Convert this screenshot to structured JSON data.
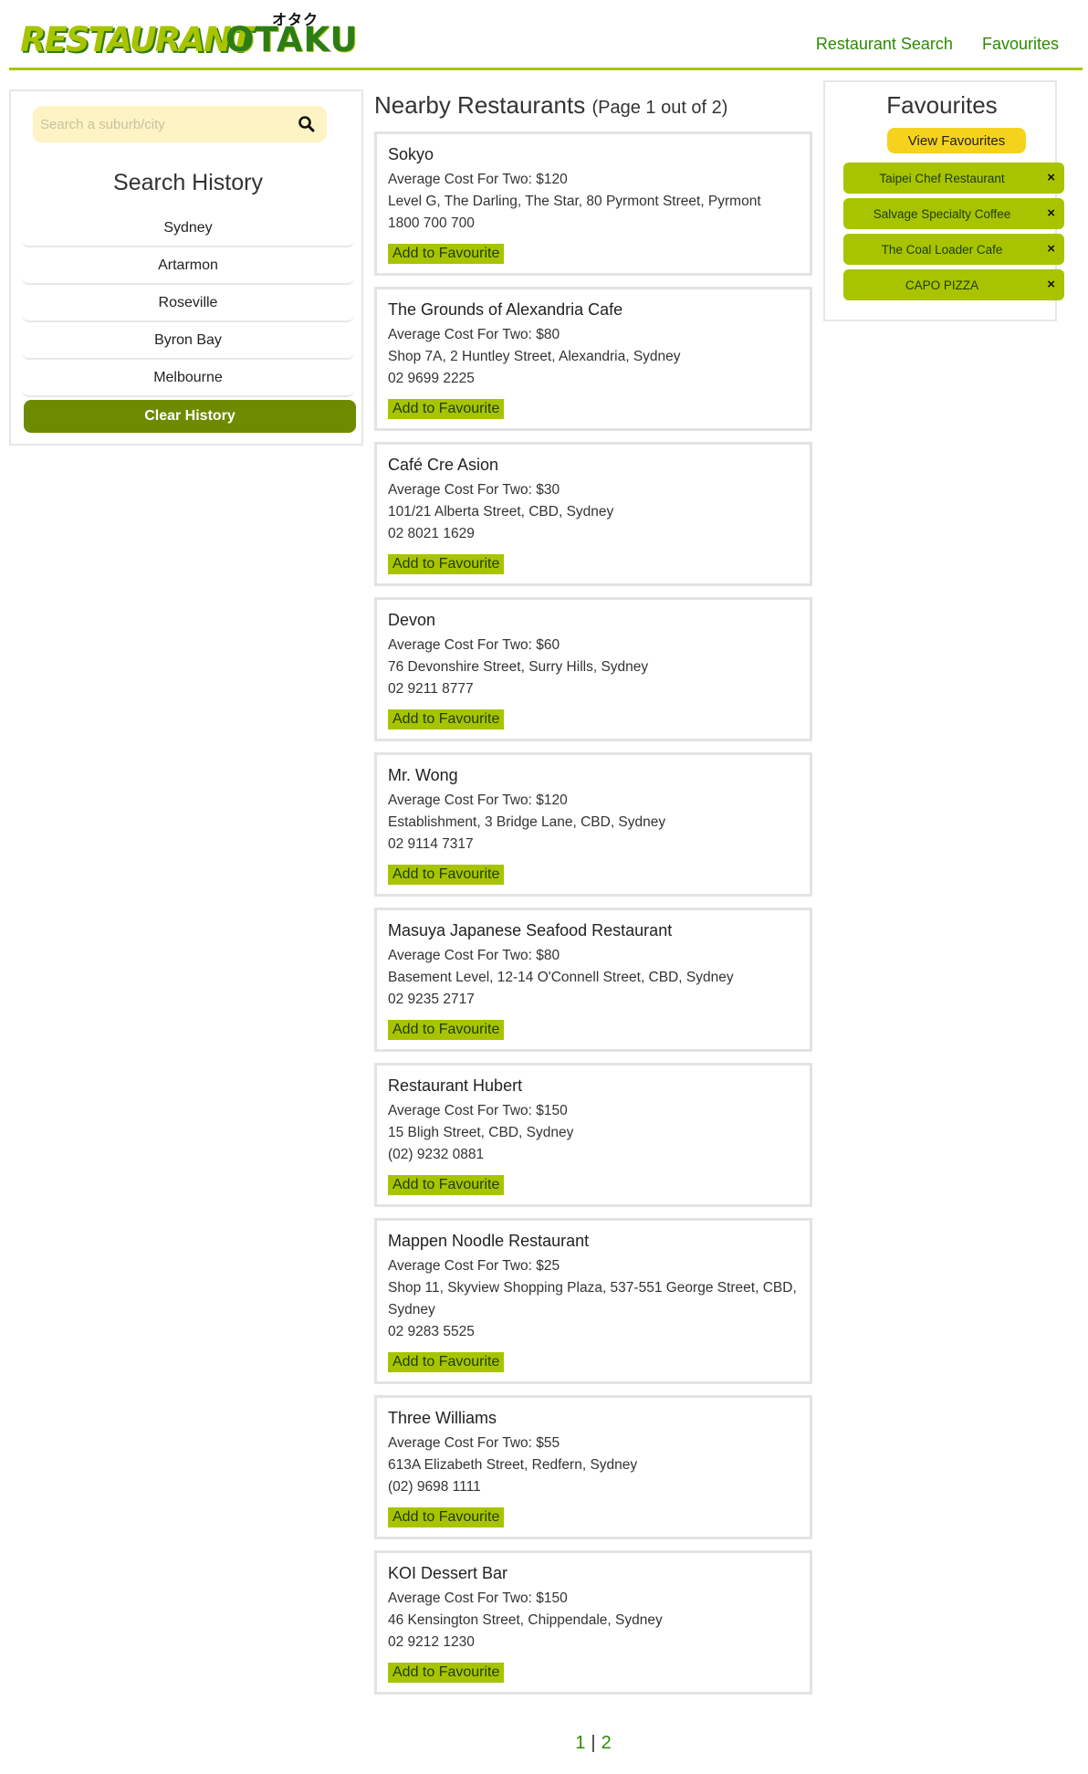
{
  "header": {
    "logo_word_1": "RESTAURANT",
    "logo_word_2": "OTAKU",
    "logo_kana": "オタク",
    "nav": [
      "Restaurant Search",
      "Favourites"
    ]
  },
  "sidebar": {
    "search_placeholder": "Search a suburb/city",
    "history_title": "Search History",
    "history": [
      "Sydney",
      "Artarmon",
      "Roseville",
      "Byron Bay",
      "Melbourne"
    ],
    "clear_label": "Clear History"
  },
  "main": {
    "title": "Nearby Restaurants",
    "page_info": "(Page 1 out of 2)",
    "add_label": "Add to Favourite",
    "restaurants": [
      {
        "name": "Sokyo",
        "cost": "Average Cost For Two: $120",
        "address": "Level G, The Darling, The Star, 80 Pyrmont Street, Pyrmont",
        "phone": "1800 700 700"
      },
      {
        "name": "The Grounds of Alexandria Cafe",
        "cost": "Average Cost For Two: $80",
        "address": "Shop 7A, 2 Huntley Street, Alexandria, Sydney",
        "phone": "02 9699 2225"
      },
      {
        "name": "Café Cre Asion",
        "cost": "Average Cost For Two: $30",
        "address": "101/21 Alberta Street, CBD, Sydney",
        "phone": "02 8021 1629"
      },
      {
        "name": "Devon",
        "cost": "Average Cost For Two: $60",
        "address": "76 Devonshire Street, Surry Hills, Sydney",
        "phone": "02 9211 8777"
      },
      {
        "name": "Mr. Wong",
        "cost": "Average Cost For Two: $120",
        "address": "Establishment, 3 Bridge Lane, CBD, Sydney",
        "phone": "02 9114 7317"
      },
      {
        "name": "Masuya Japanese Seafood Restaurant",
        "cost": "Average Cost For Two: $80",
        "address": "Basement Level, 12-14 O'Connell Street, CBD, Sydney",
        "phone": "02 9235 2717"
      },
      {
        "name": "Restaurant Hubert",
        "cost": "Average Cost For Two: $150",
        "address": "15 Bligh Street, CBD, Sydney",
        "phone": "(02) 9232 0881"
      },
      {
        "name": "Mappen Noodle Restaurant",
        "cost": "Average Cost For Two: $25",
        "address": "Shop 11, Skyview Shopping Plaza, 537-551 George Street, CBD, Sydney",
        "phone": "02 9283 5525"
      },
      {
        "name": "Three Williams",
        "cost": "Average Cost For Two: $55",
        "address": "613A Elizabeth Street, Redfern, Sydney",
        "phone": "(02) 9698 1111"
      },
      {
        "name": "KOI Dessert Bar",
        "cost": "Average Cost For Two: $150",
        "address": "46 Kensington Street, Chippendale, Sydney",
        "phone": "02 9212 1230"
      }
    ],
    "pages": [
      "1",
      "2"
    ],
    "page_sep": "|"
  },
  "favourites": {
    "title": "Favourites",
    "view_label": "View Favourites",
    "remove_glyph": "×",
    "items": [
      "Taipei Chef Restaurant",
      "Salvage Specialty Coffee",
      "The Coal Loader Cafe",
      "CAPO PIZZA"
    ]
  },
  "colors": {
    "accent": "#a8c400",
    "dark_green": "#6e8a00",
    "link_green": "#2d8a00",
    "yellow": "#f5d21c",
    "search_bg": "#fdf3c4"
  },
  "icons": {
    "search": "search-icon",
    "remove": "close-icon"
  }
}
